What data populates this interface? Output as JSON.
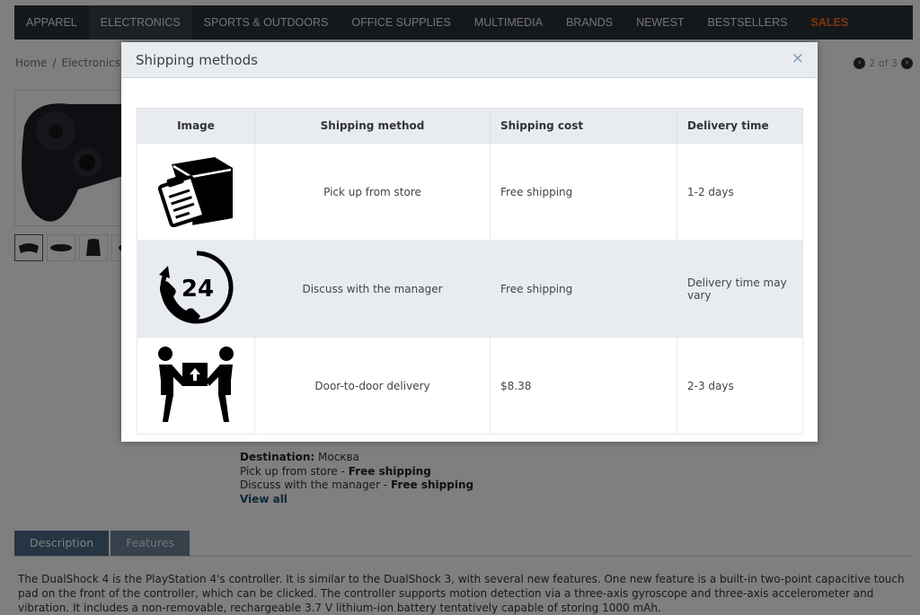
{
  "nav": {
    "items": [
      {
        "label": "APPAREL"
      },
      {
        "label": "ELECTRONICS"
      },
      {
        "label": "SPORTS & OUTDOORS"
      },
      {
        "label": "OFFICE SUPPLIES"
      },
      {
        "label": "MULTIMEDIA"
      },
      {
        "label": "BRANDS"
      },
      {
        "label": "NEWEST"
      },
      {
        "label": "BESTSELLERS"
      },
      {
        "label": "SALES"
      }
    ],
    "sales_color": "#ff6a1a"
  },
  "breadcrumb": {
    "home": "Home",
    "separator": "/",
    "category": "Electronics"
  },
  "pager": {
    "text": "2 of 3",
    "prev_icon": "chevron-left-icon",
    "next_icon": "chevron-right-icon"
  },
  "delivery": {
    "destination_label": "Destination:",
    "destination_value": "Москва",
    "line1_method": "Pick up from store -",
    "line1_cost": "Free shipping",
    "line2_method": "Discuss with the manager -",
    "line2_cost": "Free shipping",
    "view_all": "View all"
  },
  "tabs": {
    "description": "Description",
    "features": "Features"
  },
  "description_text": "The DualShock 4 is the PlayStation 4's controller. It is similar to the DualShock 3, with several new features. One new feature is a built-in two-point capacitive touch pad on the front of the controller, which can be clicked. The controller supports motion detection via a three-axis gyroscope and three-axis accelerometer and vibration. It includes a non-removable, rechargeable 3.7 V lithium-ion battery tentatively capable of storing 1000 mAh.",
  "modal": {
    "title": "Shipping methods",
    "close": "×",
    "columns": {
      "image": "Image",
      "method": "Shipping method",
      "cost": "Shipping cost",
      "time": "Delivery time"
    },
    "rows": [
      {
        "icon": "package-clipboard-icon",
        "method": "Pick up from store",
        "cost": "Free shipping",
        "time": "1-2 days"
      },
      {
        "icon": "phone-24-icon",
        "icon_text": "24",
        "method": "Discuss with the manager",
        "cost": "Free shipping",
        "time": "Delivery time may vary"
      },
      {
        "icon": "courier-handover-icon",
        "method": "Door-to-door delivery",
        "cost": "$8.38",
        "time": "2-3 days"
      }
    ]
  }
}
